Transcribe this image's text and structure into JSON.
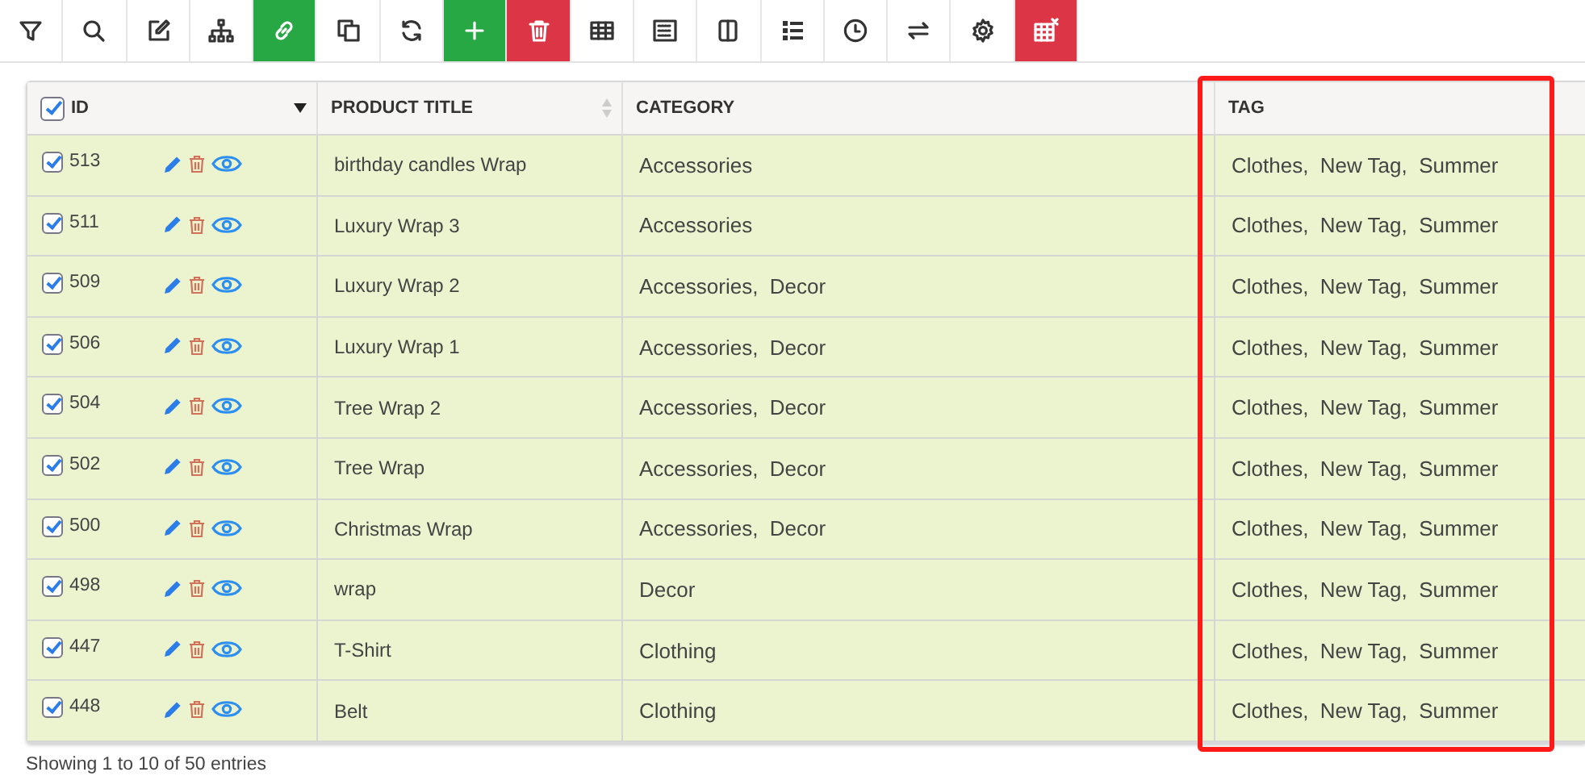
{
  "table": {
    "select_all": {
      "checked": true
    },
    "columns": [
      {
        "label": "ID"
      },
      {
        "label": "PRODUCT TITLE"
      },
      {
        "label": "CATEGORY"
      },
      {
        "label": "TAG"
      }
    ],
    "rows": [
      {
        "checked": true,
        "id": "513",
        "title": "birthday candles Wrap",
        "category": "Accessories",
        "tag": "Clothes,  New Tag,  Summer"
      },
      {
        "checked": true,
        "id": "511",
        "title": "Luxury Wrap 3",
        "category": "Accessories",
        "tag": "Clothes,  New Tag,  Summer"
      },
      {
        "checked": true,
        "id": "509",
        "title": "Luxury Wrap 2",
        "category": "Accessories,  Decor",
        "tag": "Clothes,  New Tag,  Summer"
      },
      {
        "checked": true,
        "id": "506",
        "title": "Luxury Wrap 1",
        "category": "Accessories,  Decor",
        "tag": "Clothes,  New Tag,  Summer"
      },
      {
        "checked": true,
        "id": "504",
        "title": "Tree Wrap 2",
        "category": "Accessories,  Decor",
        "tag": "Clothes,  New Tag,  Summer"
      },
      {
        "checked": true,
        "id": "502",
        "title": "Tree Wrap",
        "category": "Accessories,  Decor",
        "tag": "Clothes,  New Tag,  Summer"
      },
      {
        "checked": true,
        "id": "500",
        "title": "Christmas Wrap",
        "category": "Accessories,  Decor",
        "tag": "Clothes,  New Tag,  Summer"
      },
      {
        "checked": true,
        "id": "498",
        "title": "wrap",
        "category": "Decor",
        "tag": "Clothes,  New Tag,  Summer"
      },
      {
        "checked": true,
        "id": "447",
        "title": "T-Shirt",
        "category": "Clothing",
        "tag": "Clothes,  New Tag,  Summer"
      },
      {
        "checked": true,
        "id": "448",
        "title": "Belt",
        "category": "Clothing",
        "tag": "Clothes,  New Tag,  Summer"
      }
    ]
  },
  "status": "Showing 1 to 10 of 50 entries"
}
